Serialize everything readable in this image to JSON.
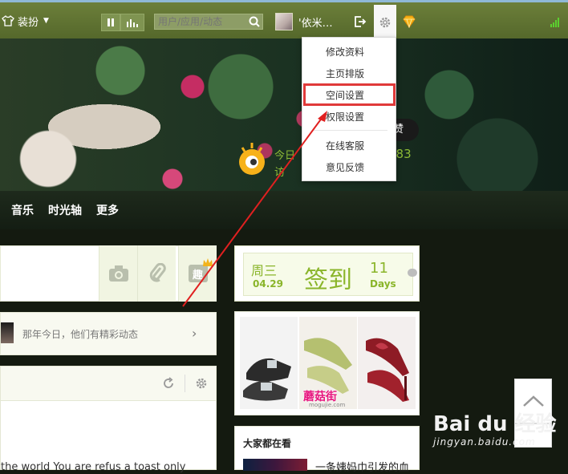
{
  "topbar": {
    "dress_label": "装扮",
    "search_placeholder": "用户/应用/动态",
    "username": "'依米…"
  },
  "dropdown": {
    "items": [
      "修改资料",
      "主页排版",
      "空间设置",
      "权限设置",
      "在线客服",
      "意见反馈"
    ]
  },
  "banner": {
    "like_label": "赞",
    "today_label": "今日",
    "visit_label": "访",
    "count": "283"
  },
  "nav": {
    "items": [
      "音乐",
      "时光轴",
      "更多"
    ]
  },
  "composer": {
    "fun_label": "趣"
  },
  "history": {
    "text": "那年今日，他们有精彩动态"
  },
  "feed": {
    "text": "the world You are refus a toast only"
  },
  "checkin": {
    "weekday": "周三",
    "date": "04.29",
    "label": "签到",
    "days_num": "11",
    "days_label": "Days"
  },
  "ad": {
    "logo": "蘑菇街",
    "domain": "mogujie.com"
  },
  "everyone": {
    "title": "大家都在看",
    "text": "一条姨妈巾引发的血"
  },
  "watermark": {
    "logo": "Bai du 经验",
    "site": "jingyan.baidu.com"
  },
  "colors": {
    "topbar": "#6c7f3a",
    "accent_green": "#8ab52a",
    "highlight_red": "#e03a3a"
  }
}
